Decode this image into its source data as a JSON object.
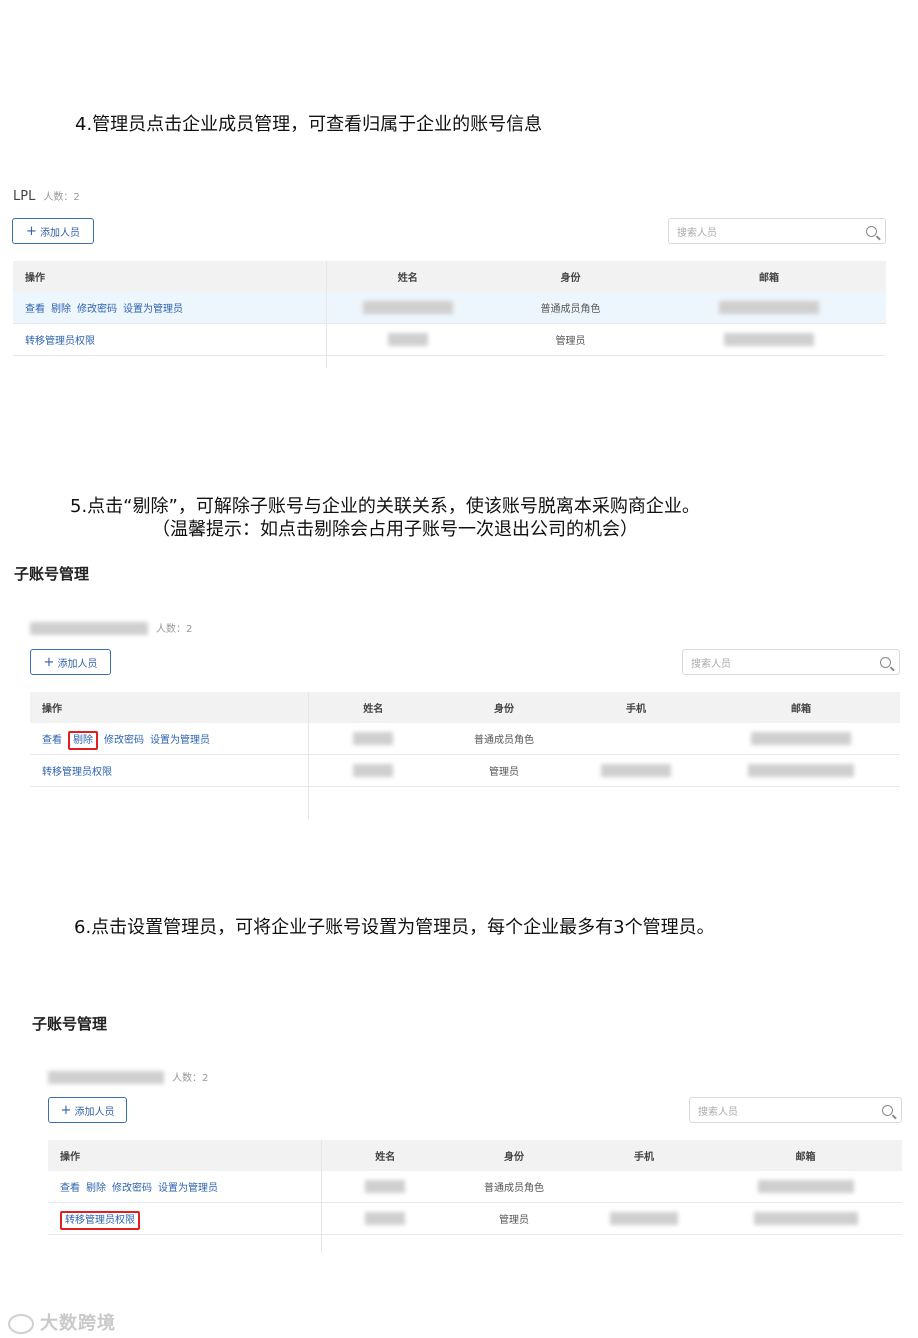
{
  "step4": {
    "text": "4.管理员点击企业成员管理，可查看归属于企业的账号信息"
  },
  "panel1": {
    "org": "LPL",
    "count": "人数：2",
    "add": "添加人员",
    "search_placeholder": "搜索人员",
    "headers": [
      "操作",
      "姓名",
      "身份",
      "邮箱"
    ],
    "row1": {
      "view": "查看",
      "remove": "剔除",
      "pwd": "修改密码",
      "setadmin": "设置为管理员",
      "role": "普通成员角色"
    },
    "row2": {
      "transfer": "转移管理员权限",
      "role": "管理员"
    }
  },
  "step5": {
    "text": "5.点击“剔除”，可解除子账号与企业的关联关系，使该账号脱离本采购商企业。",
    "tip": "（温馨提示：如点击剔除会占用子账号一次退出公司的机会）"
  },
  "panel2": {
    "title": "子账号管理",
    "count": "人数：2",
    "add": "添加人员",
    "search_placeholder": "搜索人员",
    "headers": [
      "操作",
      "姓名",
      "身份",
      "手机",
      "邮箱"
    ],
    "row1": {
      "view": "查看",
      "remove": "剔除",
      "pwd": "修改密码",
      "setadmin": "设置为管理员",
      "role": "普通成员角色"
    },
    "row2": {
      "transfer": "转移管理员权限",
      "role": "管理员"
    }
  },
  "step6": {
    "text": "6.点击设置管理员，可将企业子账号设置为管理员，每个企业最多有3个管理员。"
  },
  "panel3": {
    "title": "子账号管理",
    "count": "人数：2",
    "add": "添加人员",
    "search_placeholder": "搜索人员",
    "headers": [
      "操作",
      "姓名",
      "身份",
      "手机",
      "邮箱"
    ],
    "row1": {
      "view": "查看",
      "remove": "剔除",
      "pwd": "修改密码",
      "setadmin": "设置为管理员",
      "role": "普通成员角色"
    },
    "row2": {
      "transfer": "转移管理员权限",
      "role": "管理员"
    }
  },
  "watermark": "大数跨境",
  "colors": {
    "link": "#2e63b0",
    "highlight_box": "#e02020",
    "header_bg": "#f2f2f2"
  }
}
